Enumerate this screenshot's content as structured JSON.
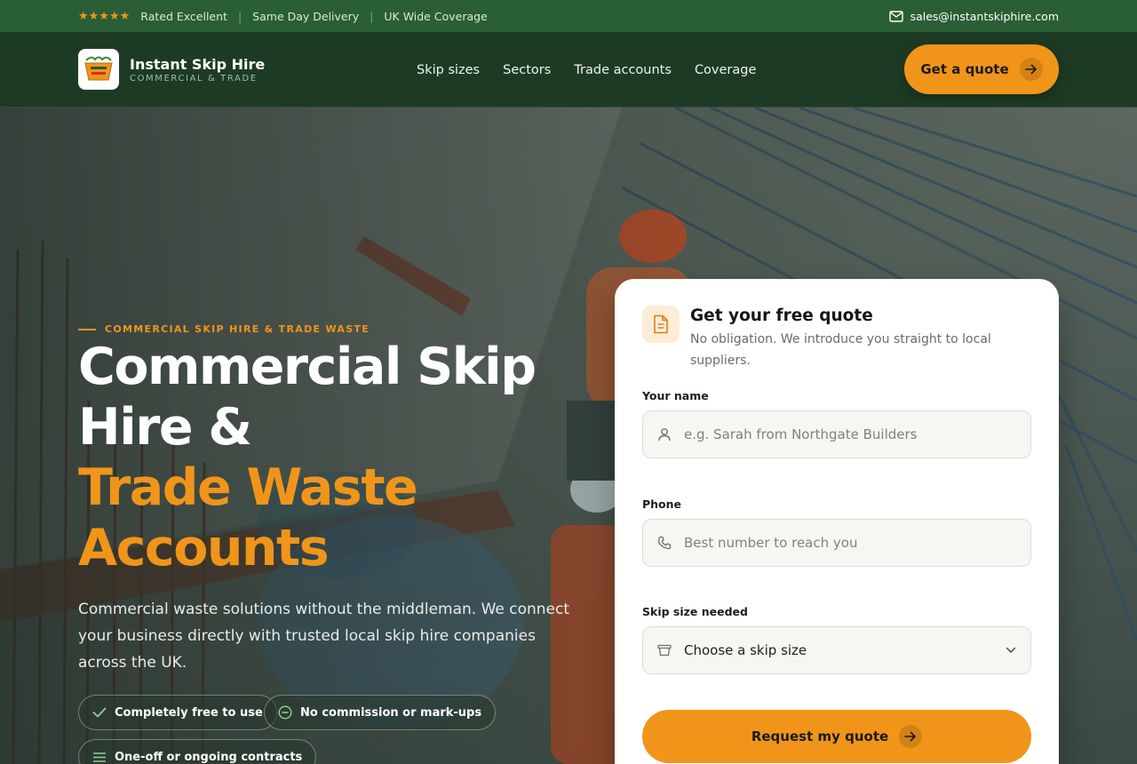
{
  "topbar": {
    "stars": "★★★★★",
    "items": [
      "Rated Excellent",
      "Same Day Delivery",
      "UK Wide Coverage"
    ],
    "email": "sales@instantskiphire.com"
  },
  "header": {
    "brand_name": "Instant Skip Hire",
    "brand_sub": "COMMERCIAL & TRADE",
    "nav": [
      "Skip sizes",
      "Sectors",
      "Trade accounts",
      "Coverage"
    ],
    "cta": "Get a quote"
  },
  "hero": {
    "eyebrow": "COMMERCIAL SKIP HIRE & TRADE WASTE",
    "title_line1": "Commercial Skip",
    "title_line2": "Hire &",
    "title_line3": "Trade Waste",
    "title_line4": "Accounts",
    "lead": "Commercial waste solutions without the middleman. We connect your business directly with trusted local skip hire companies across the UK.",
    "chips": [
      "Completely free to use",
      "No commission or mark-ups",
      "One-off or ongoing contracts"
    ]
  },
  "form": {
    "title": "Get your free quote",
    "subtitle": "No obligation. We introduce you straight to local suppliers.",
    "name_label": "Your name",
    "name_placeholder": "e.g. Sarah from Northgate Builders",
    "phone_label": "Phone",
    "phone_placeholder": "Best number to reach you",
    "skip_label": "Skip size needed",
    "skip_value": "Choose a skip size",
    "submit": "Request my quote"
  },
  "colors": {
    "accent": "#f0951a",
    "topbar": "#2a5e34",
    "header": "#1d3b24"
  }
}
